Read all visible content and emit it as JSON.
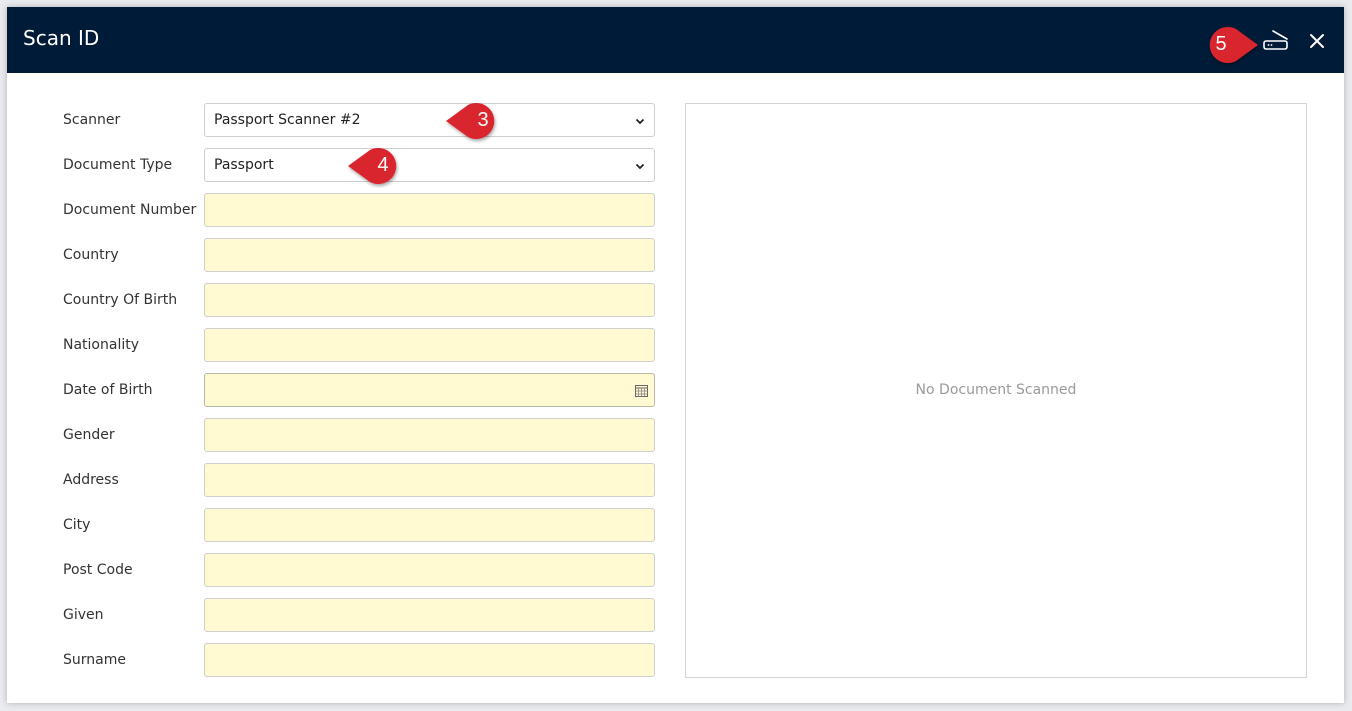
{
  "dialog": {
    "title": "Scan ID",
    "scan_icon": "scanner-icon",
    "close_icon": "close-icon"
  },
  "form": {
    "scanner": {
      "label": "Scanner",
      "value": "Passport Scanner #2"
    },
    "document_type": {
      "label": "Document Type",
      "value": "Passport"
    },
    "fields": [
      {
        "label": "Document Number",
        "value": ""
      },
      {
        "label": "Country",
        "value": ""
      },
      {
        "label": "Country Of Birth",
        "value": ""
      },
      {
        "label": "Nationality",
        "value": ""
      },
      {
        "label": "Date of Birth",
        "value": ""
      },
      {
        "label": "Gender",
        "value": ""
      },
      {
        "label": "Address",
        "value": ""
      },
      {
        "label": "City",
        "value": ""
      },
      {
        "label": "Post Code",
        "value": ""
      },
      {
        "label": "Given",
        "value": ""
      },
      {
        "label": "Surname",
        "value": ""
      }
    ]
  },
  "preview": {
    "empty_text": "No Document Scanned"
  },
  "callouts": [
    {
      "number": "3"
    },
    {
      "number": "4"
    },
    {
      "number": "5"
    }
  ],
  "colors": {
    "header_bg": "#001b37",
    "input_bg": "#fffad1",
    "callout_red": "#d9252f"
  }
}
